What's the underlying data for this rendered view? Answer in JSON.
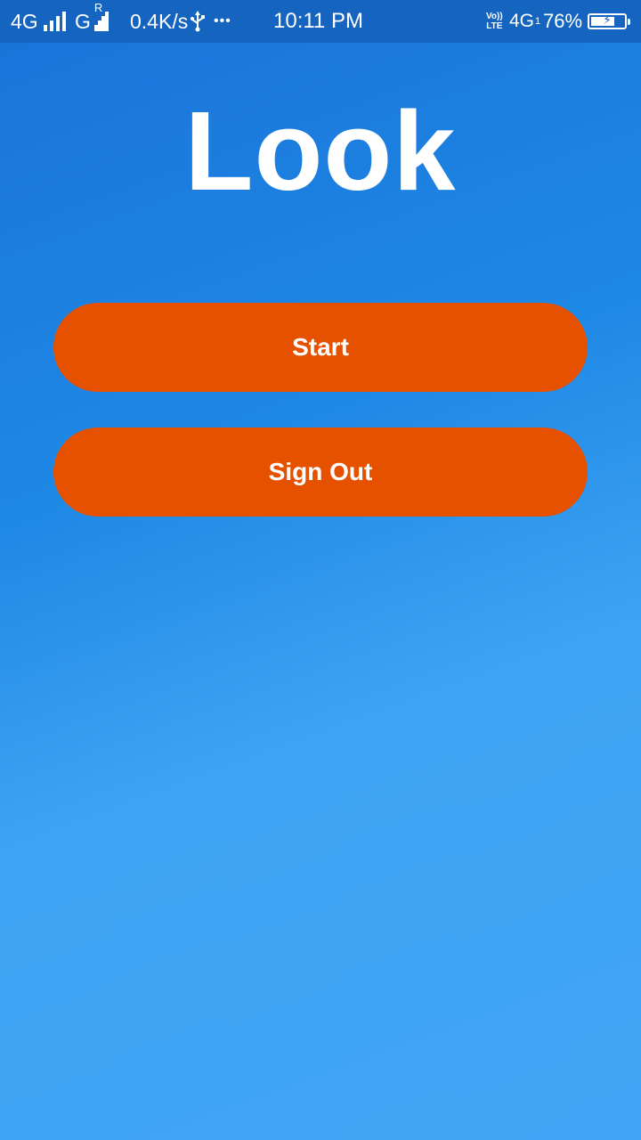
{
  "status_bar": {
    "network1": "4G",
    "network2": "G",
    "roaming": "R",
    "speed": "0.4K/s",
    "usb_icon": "usb-icon",
    "more_icon": "ellipsis-icon",
    "more": "•••",
    "time": "10:11 PM",
    "volte_top": "Vo))",
    "volte_bottom": "LTE",
    "network3": "4G",
    "network3_sub": "1",
    "battery_percent": "76%",
    "battery_level": 0.76,
    "charging": true
  },
  "app": {
    "title": "Look"
  },
  "buttons": {
    "start_label": "Start",
    "sign_out_label": "Sign Out"
  },
  "colors": {
    "status_bar": "#1565c0",
    "background_top": "#1a73d8",
    "background_bottom": "#42a5f5",
    "button": "#e65100",
    "text": "#ffffff"
  }
}
